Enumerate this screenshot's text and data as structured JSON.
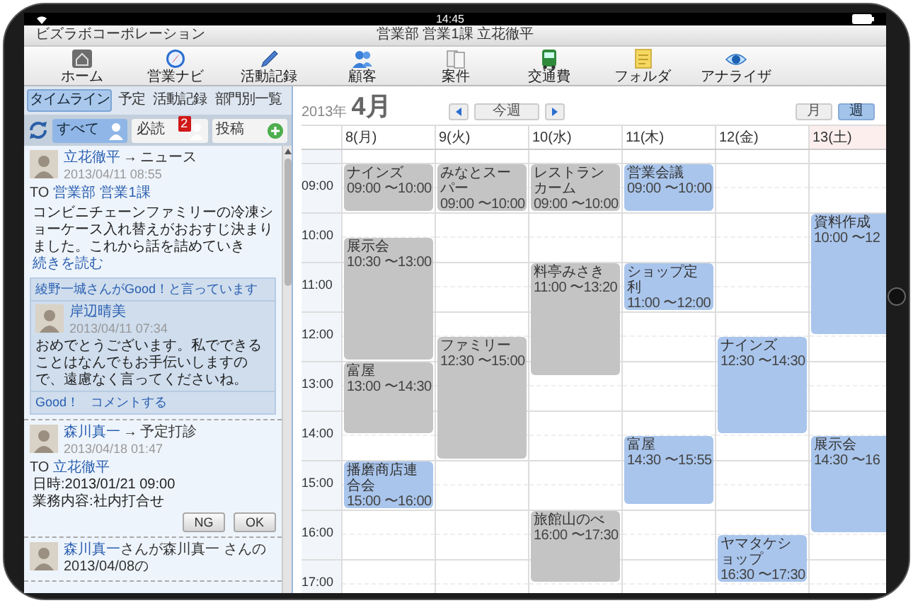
{
  "status_bar": {
    "time": "14:45"
  },
  "header": {
    "company": "ビズラボコーポレーション",
    "user": "営業部 営業1課 立花徹平"
  },
  "toolbar": [
    {
      "label": "ホーム"
    },
    {
      "label": "営業ナビ"
    },
    {
      "label": "活動記録"
    },
    {
      "label": "顧客"
    },
    {
      "label": "案件"
    },
    {
      "label": "交通費"
    },
    {
      "label": "フォルダ"
    },
    {
      "label": "アナライザ"
    }
  ],
  "sidebar": {
    "tabs": [
      {
        "label": "タイムライン",
        "selected": true
      },
      {
        "label": "予定",
        "selected": false
      },
      {
        "label": "活動記録",
        "selected": false
      },
      {
        "label": "部門別一覧",
        "selected": false
      }
    ],
    "filters": [
      {
        "kind": "people",
        "label": "すべて",
        "selected": true
      },
      {
        "kind": "people",
        "label": "必読",
        "selected": false,
        "badge": "2"
      },
      {
        "kind": "add",
        "label": "投稿",
        "selected": false
      }
    ],
    "posts": [
      {
        "kind": "news",
        "author": "立花徹平",
        "arrow": "→",
        "target": "ニュース",
        "date": "2013/04/11 08:55",
        "to_label": "TO",
        "to": [
          "営業部",
          "営業1課"
        ],
        "body": "コンビニチェーンファミリーの冷凍ショーケース入れ替えがおおすじ決まりました。これから話を詰めていき",
        "more": "続きを読む",
        "likes": "綾野一城さんがGood！と言っています",
        "comments": [
          {
            "author": "岸辺晴美",
            "date": "2013/04/11 07:34",
            "body": "おめでとうございます。私でできることはなんでもお手伝いしますので、遠慮なく言ってくださいね。"
          }
        ],
        "actions": [
          "Good！",
          "コメントする"
        ]
      },
      {
        "kind": "schedule",
        "author": "森川真一",
        "arrow": "→",
        "target": "予定打診",
        "date": "2013/04/18 01:47",
        "to_label": "TO",
        "to": [
          "立花徹平"
        ],
        "lines": [
          "日時:2013/01/21 09:00",
          "業務内容:社内打合せ"
        ],
        "buttons": [
          "NG",
          "OK"
        ]
      },
      {
        "kind": "activity",
        "author": "森川真一",
        "text": "さんが森川真一 さんの2013/04/08の"
      }
    ]
  },
  "calendar": {
    "year": "2013年",
    "month": "4月",
    "today": "今週",
    "views": [
      {
        "label": "月",
        "selected": false
      },
      {
        "label": "週",
        "selected": true
      }
    ],
    "hours": [
      "09:00",
      "10:00",
      "11:00",
      "12:00",
      "13:00",
      "14:00",
      "15:00",
      "16:00",
      "17:00"
    ],
    "days": [
      {
        "label": "8(月)",
        "weekend": false,
        "events": [
          {
            "title": "ナインズ",
            "time": "09:00 〜10:00",
            "color": "#c4c4c4"
          },
          {
            "title": "展示会",
            "time": "10:30 〜13:00",
            "color": "#c4c4c4"
          },
          {
            "title": "富屋",
            "time": "13:00 〜14:30",
            "color": "#c4c4c4"
          },
          {
            "title": "播磨商店連合会",
            "time": "15:00 〜16:00",
            "color": "#a9c5ec"
          }
        ]
      },
      {
        "label": "9(火)",
        "weekend": false,
        "events": [
          {
            "title": "みなとスーパー",
            "time": "09:00 〜10:00",
            "color": "#c4c4c4"
          },
          {
            "title": "ファミリー",
            "time": "12:30 〜15:00",
            "color": "#c4c4c4"
          }
        ]
      },
      {
        "label": "10(水)",
        "weekend": false,
        "events": [
          {
            "title": "レストランカーム",
            "time": "09:00 〜10:00",
            "color": "#c4c4c4"
          },
          {
            "title": "料亭みさき",
            "time": "11:00 〜13:20",
            "color": "#c4c4c4"
          },
          {
            "title": "旅館山のべ",
            "time": "16:00 〜17:30",
            "color": "#c4c4c4"
          }
        ]
      },
      {
        "label": "11(木)",
        "weekend": false,
        "events": [
          {
            "title": "営業会議",
            "time": "09:00 〜10:00",
            "color": "#a9c5ec"
          },
          {
            "title": "ショップ定利",
            "time": "11:00 〜12:00",
            "color": "#a9c5ec"
          },
          {
            "title": "富屋",
            "time": "14:30 〜15:55",
            "color": "#a9c5ec"
          }
        ]
      },
      {
        "label": "12(金)",
        "weekend": false,
        "events": [
          {
            "title": "ナインズ",
            "time": "12:30 〜14:30",
            "color": "#a9c5ec"
          },
          {
            "title": "ヤマタケショップ",
            "time": "16:30 〜17:30",
            "color": "#a9c5ec"
          }
        ]
      },
      {
        "label": "13(土)",
        "weekend": true,
        "events": [
          {
            "title": "資料作成",
            "time": "10:00 〜12",
            "color": "#a9c5ec"
          },
          {
            "title": "展示会",
            "time": "14:30 〜16",
            "color": "#a9c5ec"
          }
        ]
      }
    ]
  }
}
